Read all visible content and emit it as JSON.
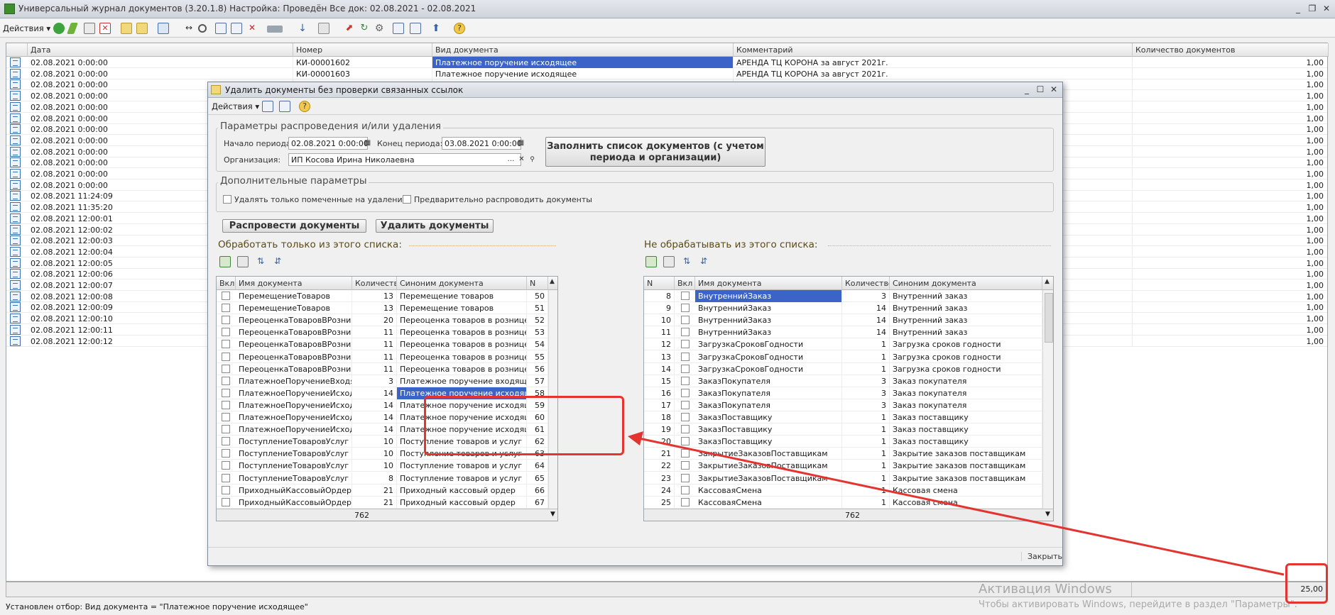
{
  "app": {
    "title": "Универсальный журнал документов (3.20.1.8) Настройка: Проведён Все док: 02.08.2021 - 02.08.2021",
    "actions_label": "Действия",
    "status_text": "Установлен отбор: Вид документа = \"Платежное поручение исходящее\"",
    "total": "25,00"
  },
  "main_table": {
    "columns": [
      "Дата",
      "Номер",
      "Вид документа",
      "Комментарий",
      "Количество документов"
    ],
    "rows": [
      {
        "date": "02.08.2021 0:00:00",
        "number": "КИ-00001602",
        "kind": "Платежное поручение исходящее",
        "comment": "АРЕНДА ТЦ КОРОНА за август 2021г.",
        "count": "1,00"
      },
      {
        "date": "02.08.2021 0:00:00",
        "number": "КИ-00001603",
        "kind": "Платежное поручение исходящее",
        "comment": "АРЕНДА ТЦ КОРОНА за август 2021г.",
        "count": "1,00"
      },
      {
        "date": "02.08.2021 0:00:00",
        "number": "",
        "kind": "",
        "comment": "",
        "count": "1,00"
      },
      {
        "date": "02.08.2021 0:00:00",
        "number": "",
        "kind": "",
        "comment": "",
        "count": "1,00"
      },
      {
        "date": "02.08.2021 0:00:00",
        "number": "",
        "kind": "",
        "comment": "",
        "count": "1,00"
      },
      {
        "date": "02.08.2021 0:00:00",
        "number": "",
        "kind": "",
        "comment": "",
        "count": "1,00"
      },
      {
        "date": "02.08.2021 0:00:00",
        "number": "",
        "kind": "",
        "comment": "",
        "count": "1,00"
      },
      {
        "date": "02.08.2021 0:00:00",
        "number": "",
        "kind": "",
        "comment": "",
        "count": "1,00"
      },
      {
        "date": "02.08.2021 0:00:00",
        "number": "",
        "kind": "",
        "comment": "",
        "count": "1,00"
      },
      {
        "date": "02.08.2021 0:00:00",
        "number": "",
        "kind": "",
        "comment": "",
        "count": "1,00"
      },
      {
        "date": "02.08.2021 0:00:00",
        "number": "",
        "kind": "",
        "comment": "",
        "count": "1,00"
      },
      {
        "date": "02.08.2021 0:00:00",
        "number": "",
        "kind": "",
        "comment": "",
        "count": "1,00"
      },
      {
        "date": "02.08.2021 11:24:09",
        "number": "",
        "kind": "",
        "comment": "",
        "count": "1,00"
      },
      {
        "date": "02.08.2021 11:35:20",
        "number": "",
        "kind": "",
        "comment": "",
        "count": "1,00"
      },
      {
        "date": "02.08.2021 12:00:01",
        "number": "",
        "kind": "",
        "comment": "",
        "count": "1,00"
      },
      {
        "date": "02.08.2021 12:00:02",
        "number": "",
        "kind": "",
        "comment": "",
        "count": "1,00"
      },
      {
        "date": "02.08.2021 12:00:03",
        "number": "",
        "kind": "",
        "comment": "",
        "count": "1,00"
      },
      {
        "date": "02.08.2021 12:00:04",
        "number": "",
        "kind": "",
        "comment": "",
        "count": "1,00"
      },
      {
        "date": "02.08.2021 12:00:05",
        "number": "",
        "kind": "",
        "comment": "",
        "count": "1,00"
      },
      {
        "date": "02.08.2021 12:00:06",
        "number": "",
        "kind": "",
        "comment": "",
        "count": "1,00"
      },
      {
        "date": "02.08.2021 12:00:07",
        "number": "",
        "kind": "",
        "comment": "",
        "count": "1,00"
      },
      {
        "date": "02.08.2021 12:00:08",
        "number": "",
        "kind": "",
        "comment": "",
        "count": "1,00"
      },
      {
        "date": "02.08.2021 12:00:09",
        "number": "",
        "kind": "",
        "comment": "",
        "count": "1,00"
      },
      {
        "date": "02.08.2021 12:00:10",
        "number": "",
        "kind": "",
        "comment": "",
        "count": "1,00"
      },
      {
        "date": "02.08.2021 12:00:11",
        "number": "",
        "kind": "",
        "comment": "",
        "count": "1,00"
      },
      {
        "date": "02.08.2021 12:00:12",
        "number": "",
        "kind": "",
        "comment": "",
        "count": "1,00"
      }
    ]
  },
  "dialog": {
    "title": "Удалить документы без проверки связанных ссылок",
    "actions_label": "Действия",
    "params_group": "Параметры распроведения и/или удаления",
    "period_start_label": "Начало периода:",
    "period_start": "02.08.2021  0:00:00",
    "period_end_label": "Конец периода:",
    "period_end": "03.08.2021  0:00:00",
    "org_label": "Организация:",
    "org_value": "ИП Косова Ирина Николаевна",
    "fill_button": "Заполнить список документов (с учетом периода и организации)",
    "extra_group": "Дополнительные параметры",
    "opt_marked": "Удалять только помеченные на удаление",
    "opt_prepost": "Предварительно распроводить документы",
    "unpost_button": "Распровести документы",
    "delete_button": "Удалить документы",
    "close_button": "Закрыть",
    "left": {
      "label": "Обработать только из этого списка:",
      "columns": [
        "Вкл",
        "Имя документа",
        "Количество",
        "Синоним документа",
        "N"
      ],
      "total": "762",
      "rows": [
        {
          "name": "ПеремещениеТоваров",
          "qty": "13",
          "syn": "Перемещение товаров",
          "n": "50"
        },
        {
          "name": "ПеремещениеТоваров",
          "qty": "13",
          "syn": "Перемещение товаров",
          "n": "51"
        },
        {
          "name": "ПереоценкаТоваровВРознице",
          "qty": "20",
          "syn": "Переоценка товаров в рознице",
          "n": "52"
        },
        {
          "name": "ПереоценкаТоваровВРознице",
          "qty": "11",
          "syn": "Переоценка товаров в рознице",
          "n": "53"
        },
        {
          "name": "ПереоценкаТоваровВРознице",
          "qty": "11",
          "syn": "Переоценка товаров в рознице",
          "n": "54"
        },
        {
          "name": "ПереоценкаТоваровВРознице",
          "qty": "11",
          "syn": "Переоценка товаров в рознице",
          "n": "55"
        },
        {
          "name": "ПереоценкаТоваровВРознице",
          "qty": "11",
          "syn": "Переоценка товаров в рознице",
          "n": "56"
        },
        {
          "name": "ПлатежноеПоручениеВходящее",
          "qty": "3",
          "syn": "Платежное поручение входящее",
          "n": "57"
        },
        {
          "name": "ПлатежноеПоручениеИсходящее",
          "qty": "14",
          "syn": "Платежное поручение исходящее",
          "n": "58"
        },
        {
          "name": "ПлатежноеПоручениеИсходящее",
          "qty": "14",
          "syn": "Платежное поручение исходящее",
          "n": "59"
        },
        {
          "name": "ПлатежноеПоручениеИсходящее",
          "qty": "14",
          "syn": "Платежное поручение исходящее",
          "n": "60"
        },
        {
          "name": "ПлатежноеПоручениеИсходящее",
          "qty": "14",
          "syn": "Платежное поручение исходящее",
          "n": "61"
        },
        {
          "name": "ПоступлениеТоваровУслуг",
          "qty": "10",
          "syn": "Поступление товаров и услуг",
          "n": "62"
        },
        {
          "name": "ПоступлениеТоваровУслуг",
          "qty": "10",
          "syn": "Поступление товаров и услуг",
          "n": "63"
        },
        {
          "name": "ПоступлениеТоваровУслуг",
          "qty": "10",
          "syn": "Поступление товаров и услуг",
          "n": "64"
        },
        {
          "name": "ПоступлениеТоваровУслуг",
          "qty": "8",
          "syn": "Поступление товаров и услуг",
          "n": "65"
        },
        {
          "name": "ПриходныйКассовыйОрдер",
          "qty": "21",
          "syn": "Приходный кассовый ордер",
          "n": "66"
        },
        {
          "name": "ПриходныйКассовыйОрдер",
          "qty": "21",
          "syn": "Приходный кассовый ордер",
          "n": "67"
        }
      ]
    },
    "right": {
      "label": "Не обрабатывать из этого списка:",
      "columns": [
        "N",
        "Вкл",
        "Имя документа",
        "Количество",
        "Синоним документа"
      ],
      "total": "762",
      "rows": [
        {
          "n": "8",
          "name": "ВнутреннийЗаказ",
          "qty": "3",
          "syn": "Внутренний заказ"
        },
        {
          "n": "9",
          "name": "ВнутреннийЗаказ",
          "qty": "14",
          "syn": "Внутренний заказ"
        },
        {
          "n": "10",
          "name": "ВнутреннийЗаказ",
          "qty": "14",
          "syn": "Внутренний заказ"
        },
        {
          "n": "11",
          "name": "ВнутреннийЗаказ",
          "qty": "14",
          "syn": "Внутренний заказ"
        },
        {
          "n": "12",
          "name": "ЗагрузкаСроковГодности",
          "qty": "1",
          "syn": "Загрузка сроков годности"
        },
        {
          "n": "13",
          "name": "ЗагрузкаСроковГодности",
          "qty": "1",
          "syn": "Загрузка сроков годности"
        },
        {
          "n": "14",
          "name": "ЗагрузкаСроковГодности",
          "qty": "1",
          "syn": "Загрузка сроков годности"
        },
        {
          "n": "15",
          "name": "ЗаказПокупателя",
          "qty": "3",
          "syn": "Заказ покупателя"
        },
        {
          "n": "16",
          "name": "ЗаказПокупателя",
          "qty": "3",
          "syn": "Заказ покупателя"
        },
        {
          "n": "17",
          "name": "ЗаказПокупателя",
          "qty": "3",
          "syn": "Заказ покупателя"
        },
        {
          "n": "18",
          "name": "ЗаказПоставщику",
          "qty": "1",
          "syn": "Заказ поставщику"
        },
        {
          "n": "19",
          "name": "ЗаказПоставщику",
          "qty": "1",
          "syn": "Заказ поставщику"
        },
        {
          "n": "20",
          "name": "ЗаказПоставщику",
          "qty": "1",
          "syn": "Заказ поставщику"
        },
        {
          "n": "21",
          "name": "ЗакрытиеЗаказовПоставщикам",
          "qty": "1",
          "syn": "Закрытие заказов поставщикам"
        },
        {
          "n": "22",
          "name": "ЗакрытиеЗаказовПоставщикам",
          "qty": "1",
          "syn": "Закрытие заказов поставщикам"
        },
        {
          "n": "23",
          "name": "ЗакрытиеЗаказовПоставщикам",
          "qty": "1",
          "syn": "Закрытие заказов поставщикам"
        },
        {
          "n": "24",
          "name": "КассоваяСмена",
          "qty": "1",
          "syn": "Кассовая смена"
        },
        {
          "n": "25",
          "name": "КассоваяСмена",
          "qty": "1",
          "syn": "Кассовая смена"
        }
      ]
    }
  },
  "watermark": {
    "line1": "Активация Windows",
    "line2": "Чтобы активировать Windows, перейдите в раздел \"Параметры\"."
  },
  "colors": {
    "selection": "#3c64c8",
    "highlight_red": "#e3342f"
  }
}
